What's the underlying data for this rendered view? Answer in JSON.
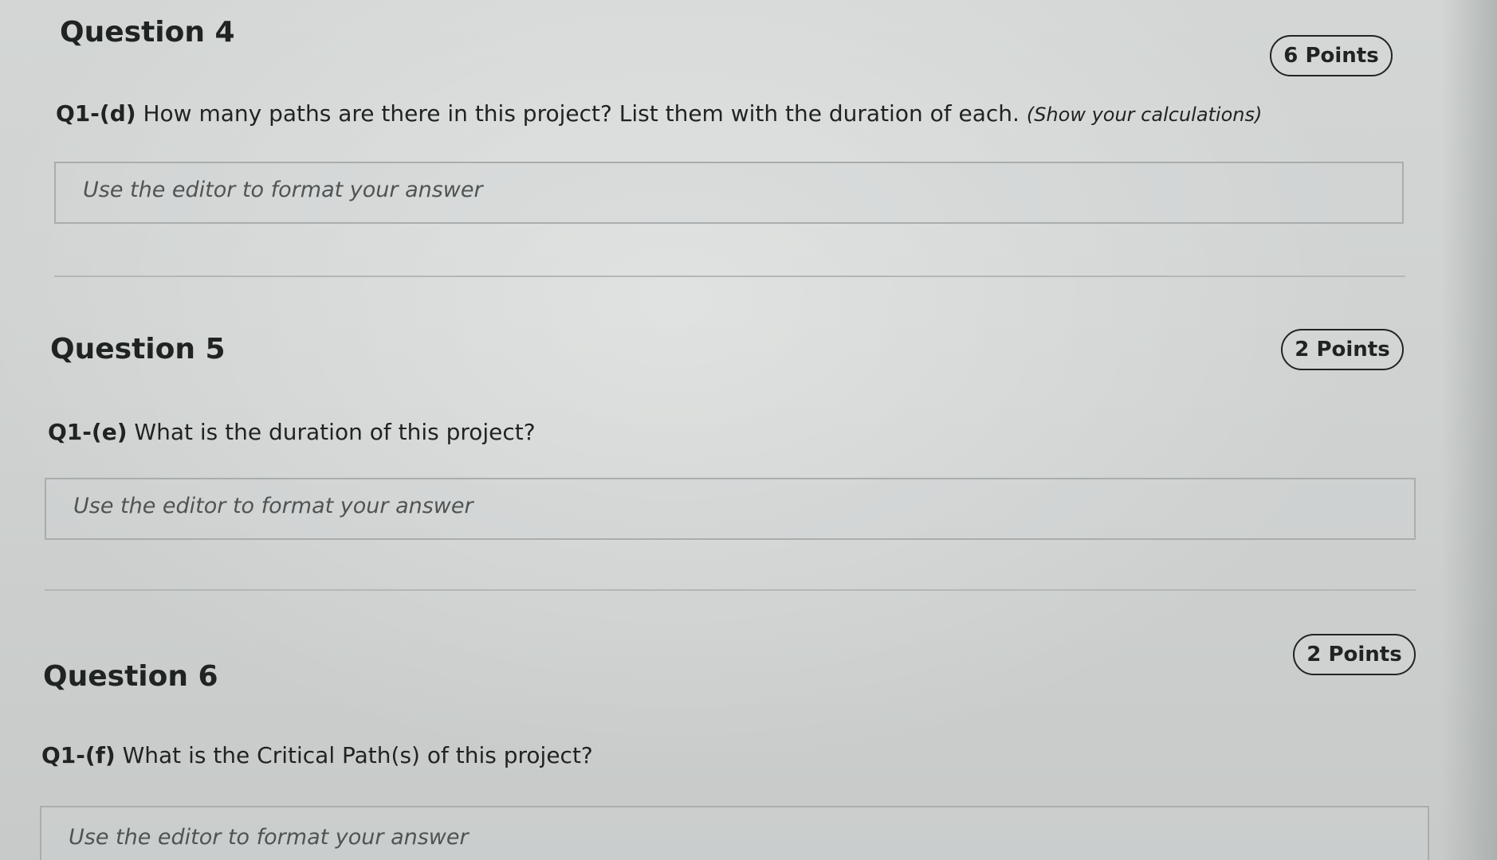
{
  "questions": [
    {
      "title": "Question 4",
      "points": "6 Points",
      "code": "Q1-(d)",
      "prompt": "How many paths are there in this project? List them with the duration of each.",
      "hint": "(Show your calculations)",
      "answer_placeholder": "Use the editor to format your answer"
    },
    {
      "title": "Question 5",
      "points": "2 Points",
      "code": "Q1-(e)",
      "prompt": "What is the duration of this project?",
      "answer_placeholder": "Use the editor to format your answer"
    },
    {
      "title": "Question 6",
      "points": "2 Points",
      "code": "Q1-(f)",
      "prompt": "What is the Critical Path(s) of this project?",
      "answer_placeholder": "Use the editor to format your answer"
    }
  ]
}
